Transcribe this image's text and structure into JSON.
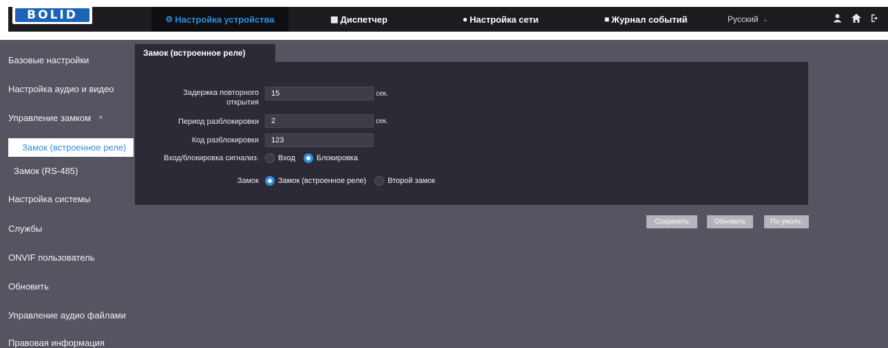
{
  "header": {
    "logo": "BOLID",
    "nav": {
      "device": "Настройка устройства",
      "dispatch": "Диспетчер",
      "network": "Настройка сети",
      "journal": "Журнал событий",
      "language": "Русский"
    }
  },
  "sidebar": {
    "items": [
      {
        "label": "Базовые настройки"
      },
      {
        "label": "Настройка аудио и видео"
      },
      {
        "label": "Управление замком"
      },
      {
        "label": "Замок (встроенное реле)"
      },
      {
        "label": "Замок (RS-485)"
      },
      {
        "label": "Настройка системы"
      },
      {
        "label": "Службы"
      },
      {
        "label": "ONVIF пользователь"
      },
      {
        "label": "Обновить"
      },
      {
        "label": "Управление аудио файлами"
      },
      {
        "label": "Правовая информация"
      }
    ]
  },
  "main": {
    "tab": "Замок (встроенное реле)",
    "reopen_delay": {
      "label_line1": "Задержка повторного",
      "label_line2": "открытия",
      "value": "15",
      "unit": "сек."
    },
    "unlock_period": {
      "label": "Период разблокировки",
      "value": "2",
      "unit": "сек."
    },
    "unlock_code": {
      "label": "Код разблокировки",
      "value": "123"
    },
    "alarm_input": {
      "label": "Вход/блокировка сигнализ.",
      "opt1": "Вход",
      "opt2": "Блокировка",
      "selected": "Блокировка"
    },
    "lock": {
      "label": "Замок",
      "opt1": "Замок (встроенное реле)",
      "opt2": "Второй замок",
      "selected": "Замок (встроенное реле)"
    },
    "buttons": {
      "save": "Сохранить",
      "refresh": "Обновить",
      "default": "По умолч."
    }
  },
  "colors": {
    "accent": "#2f8fe4",
    "background": "#555460",
    "panel": "#2c2b35"
  }
}
